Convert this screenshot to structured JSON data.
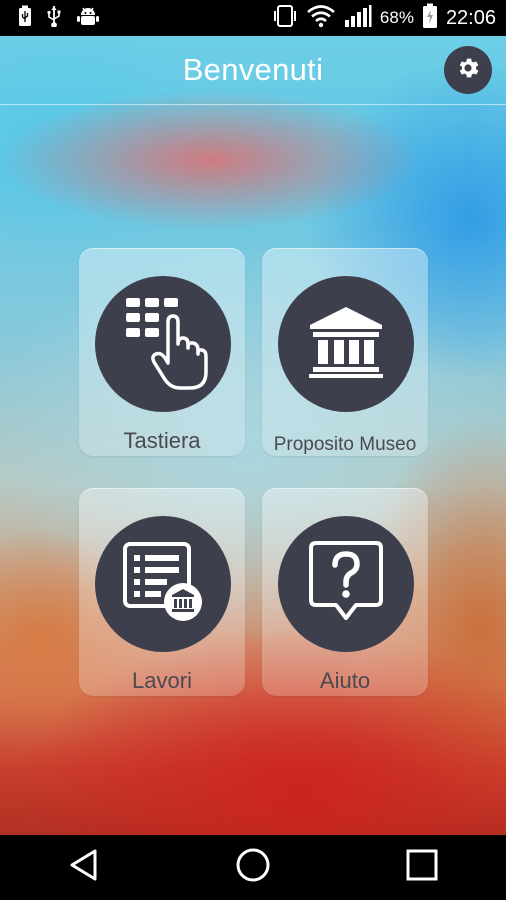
{
  "status_bar": {
    "battery_percent": "68%",
    "time": "22:06",
    "left_icons": [
      "usb-charging-icon",
      "usb-icon",
      "android-debug-icon"
    ],
    "right_icons": [
      "vibrate-icon",
      "wifi-icon",
      "signal-icon",
      "battery-icon"
    ]
  },
  "app_bar": {
    "title": "Benvenuti",
    "settings_icon": "gear-icon"
  },
  "tiles": [
    {
      "label": "Tastiera",
      "icon": "keypad-hand-icon"
    },
    {
      "label": "Proposito Museo",
      "icon": "museum-icon"
    },
    {
      "label": "Lavori",
      "icon": "list-museum-icon"
    },
    {
      "label": "Aiuto",
      "icon": "help-bubble-icon"
    }
  ],
  "nav_bar": {
    "buttons": [
      "back-icon",
      "home-icon",
      "recents-icon"
    ]
  },
  "colors": {
    "icon_circle": "#3d3f4d",
    "label_text": "#4a4a4f",
    "title_text": "#ffffff"
  }
}
